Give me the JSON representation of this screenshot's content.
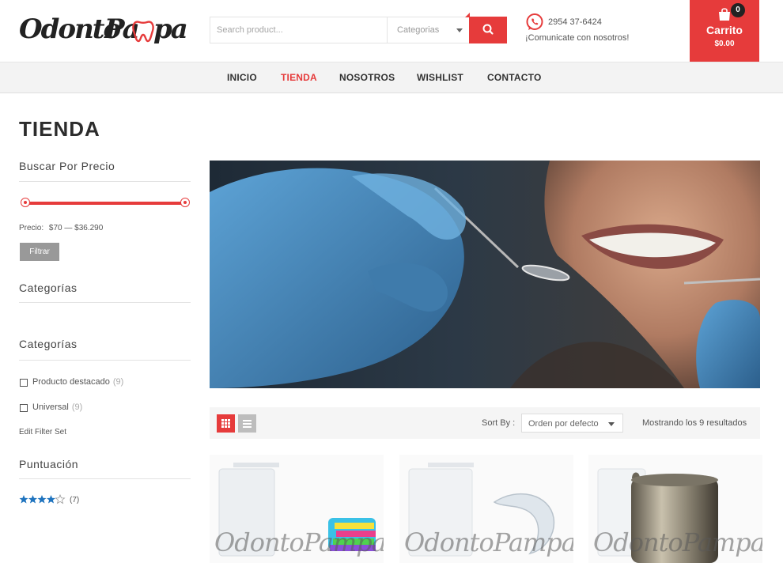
{
  "brand": {
    "logo_text_1": "Odonto",
    "logo_text_2": "Pa",
    "logo_text_3": "pa"
  },
  "search": {
    "placeholder": "Search product...",
    "category": "Categorias"
  },
  "contact": {
    "phone": "2954 37-6424",
    "text": "¡Comunicate con nosotros!"
  },
  "cart": {
    "count": "0",
    "label": "Carrito",
    "total": "$0.00"
  },
  "nav": {
    "items": [
      "INICIO",
      "TIENDA",
      "NOSOTROS",
      "WISHLIST",
      "CONTACTO"
    ],
    "active": "TIENDA"
  },
  "page": {
    "title": "TIENDA"
  },
  "sidebar": {
    "price_widget": {
      "title": "Buscar Por Precio",
      "price_label": "Precio:",
      "price_range": "$70 — $36.290",
      "filter_button": "Filtrar"
    },
    "categories_widget_1": {
      "title": "Categorías"
    },
    "categories_widget_2": {
      "title": "Categorías",
      "items": [
        {
          "label": "Producto destacado",
          "count": "(9)"
        },
        {
          "label": "Universal",
          "count": "(9)"
        }
      ],
      "edit_link": "Edit Filter Set"
    },
    "rating_widget": {
      "title": "Puntuación",
      "stars": 4,
      "count": "(7)"
    }
  },
  "toolbar": {
    "sort_label": "Sort By :",
    "sort_value": "Orden por defecto",
    "result_count": "Mostrando los 9 resultados"
  },
  "products": {
    "watermark": "OdontoPampa"
  },
  "colors": {
    "accent": "#e63b3b",
    "nav_bg": "#f3f3f3",
    "star": "#1e73be"
  }
}
